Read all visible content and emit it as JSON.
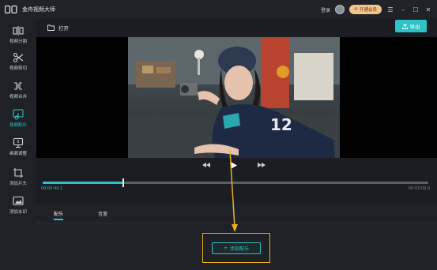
{
  "app": {
    "title": "金舟视频大师"
  },
  "titlebar": {
    "login_label": "登录",
    "vip_label": "开通会员",
    "controls": {
      "menu": "☰",
      "minimize": "–",
      "maximize": "☐",
      "close": "✕"
    }
  },
  "sidebar": {
    "items": [
      {
        "label": "视频分割",
        "icon": "split-icon"
      },
      {
        "label": "视频剪切",
        "icon": "scissors-icon"
      },
      {
        "label": "视频合并",
        "icon": "merge-icon"
      },
      {
        "label": "视频配乐",
        "icon": "music-icon",
        "active": true
      },
      {
        "label": "画面调整",
        "icon": "adjust-icon"
      },
      {
        "label": "添加片头",
        "icon": "intro-icon"
      },
      {
        "label": "添加水印",
        "icon": "watermark-icon"
      }
    ]
  },
  "toolbar": {
    "open_label": "打开",
    "export_label": "导出"
  },
  "player": {
    "current_time": "00:00:40.1",
    "total_time": "00:03:09.0",
    "progress": 0.21
  },
  "panel": {
    "tabs": [
      {
        "label": "配乐",
        "active": true
      },
      {
        "label": "音量",
        "active": false
      }
    ],
    "add_music_label": "添加配乐"
  },
  "colors": {
    "accent": "#2ec2c6",
    "highlight": "#e7b21d",
    "vip": "#f2c489"
  }
}
